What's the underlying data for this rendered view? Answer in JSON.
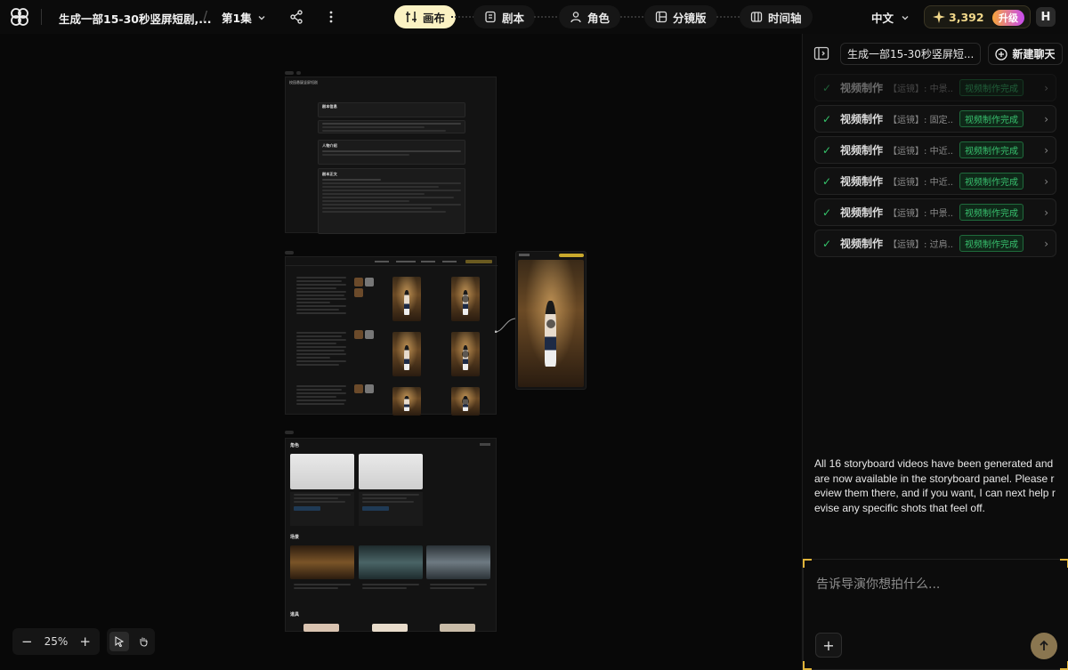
{
  "header": {
    "project_title": "生成一部15-30秒竖屏短剧,...",
    "episode": "第1集",
    "tabs": [
      {
        "label": "画布",
        "icon": "canvas-icon",
        "active": true
      },
      {
        "label": "剧本",
        "icon": "script-icon",
        "active": false
      },
      {
        "label": "角色",
        "icon": "character-icon",
        "active": false
      },
      {
        "label": "分镜版",
        "icon": "storyboard-icon",
        "active": false
      },
      {
        "label": "时间轴",
        "icon": "timeline-icon",
        "active": false
      }
    ],
    "language": "中文",
    "credits": "3,392",
    "upgrade_label": "升级",
    "avatar_initial": "H"
  },
  "canvas": {
    "zoom": "25%",
    "script_doc": {
      "title": "校园悬疑竖屏短剧",
      "sections": [
        "剧本信息",
        "人物介绍",
        "剧本正文"
      ]
    },
    "assets": {
      "characters_heading": "角色",
      "scenes_heading": "场景",
      "props_heading": "道具"
    }
  },
  "panel": {
    "chat_title": "生成一部15-30秒竖屏短...",
    "new_chat_label": "新建聊天",
    "tasks": [
      {
        "name": "视频制作",
        "desc": "【运镜】: 中景...",
        "status": "视频制作完成"
      },
      {
        "name": "视频制作",
        "desc": "【运镜】: 固定...",
        "status": "视频制作完成"
      },
      {
        "name": "视频制作",
        "desc": "【运镜】: 中近...",
        "status": "视频制作完成"
      },
      {
        "name": "视频制作",
        "desc": "【运镜】: 中近...",
        "status": "视频制作完成"
      },
      {
        "name": "视频制作",
        "desc": "【运镜】: 中景...",
        "status": "视频制作完成"
      },
      {
        "name": "视频制作",
        "desc": "【运镜】: 过肩...",
        "status": "视频制作完成"
      }
    ],
    "message": "All 16 storyboard videos have been generated and are now available in the storyboard panel. Please review them there, and if you want, I can next help revise any specific shots that feel off.",
    "input_placeholder": "告诉导演你想拍什么..."
  },
  "colors": {
    "active_tab_bg": "#fbf2c3",
    "success_green": "#38c06e",
    "accent_gold": "#e0b43a"
  }
}
